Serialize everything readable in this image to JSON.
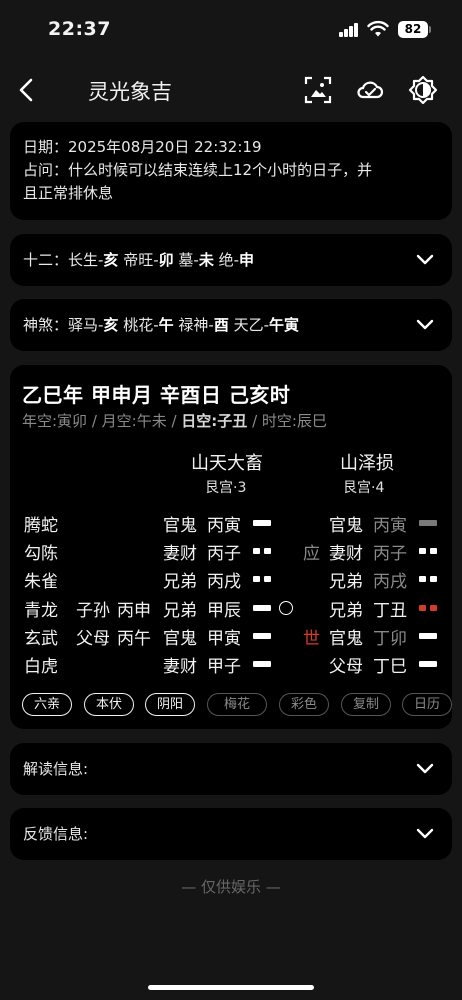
{
  "status": {
    "time": "22:37",
    "battery": "82"
  },
  "nav": {
    "title": "灵光象吉"
  },
  "info": {
    "date_line": "日期：2025年08月20日 22:32:19",
    "question_line1": "占问：什么时候可以结束连续上12个小时的日子，并",
    "question_line2": "且正常排休息"
  },
  "twelve": {
    "prefix": "十二：长生-",
    "b1": "亥",
    "t2": " 帝旺-",
    "b2": "卯",
    "t3": " 墓-",
    "b3": "未",
    "t4": " 绝-",
    "b4": "申"
  },
  "shensha": {
    "prefix": "神煞：驿马-",
    "b1": "亥",
    "t2": " 桃花-",
    "b2": "午",
    "t3": " 禄神-",
    "b3": "酉",
    "t4": " 天乙-",
    "b4": "午寅"
  },
  "gua": {
    "title": "乙巳年 甲申月 辛酉日 己亥时",
    "kong_a": "年空:寅卯 / 月空:午未 / ",
    "kong_b": "日空:子丑",
    "kong_c": " / 时空:辰巳",
    "main_name": "山天大畜",
    "main_palace": "艮宫·3",
    "change_name": "山泽损",
    "change_palace": "艮宫·4"
  },
  "rows": [
    {
      "god": "腾蛇",
      "fu_rel": "",
      "fu_branch": "",
      "rel": "官鬼",
      "branch": "丙寅",
      "line": "yang",
      "shi": "",
      "c_rel": "官鬼",
      "c_branch": "丙寅",
      "c_line": "yang-grey"
    },
    {
      "god": "勾陈",
      "fu_rel": "",
      "fu_branch": "",
      "rel": "妻财",
      "branch": "丙子",
      "line": "yin",
      "shi": "应",
      "c_rel": "妻财",
      "c_branch": "丙子",
      "c_line": "yin"
    },
    {
      "god": "朱雀",
      "fu_rel": "",
      "fu_branch": "",
      "rel": "兄弟",
      "branch": "丙戌",
      "line": "yin",
      "shi": "",
      "c_rel": "兄弟",
      "c_branch": "丙戌",
      "c_line": "yin"
    },
    {
      "god": "青龙",
      "fu_rel": "子孙",
      "fu_branch": "丙申",
      "rel": "兄弟",
      "branch": "甲辰",
      "line": "yang",
      "shi": "",
      "c_rel": "兄弟",
      "c_branch": "丁丑",
      "c_line": "yin-red"
    },
    {
      "god": "玄武",
      "fu_rel": "父母",
      "fu_branch": "丙午",
      "rel": "官鬼",
      "branch": "甲寅",
      "line": "yang",
      "shi": "世",
      "c_rel": "官鬼",
      "c_branch": "丁卯",
      "c_line": "yang"
    },
    {
      "god": "白虎",
      "fu_rel": "",
      "fu_branch": "",
      "rel": "妻财",
      "branch": "甲子",
      "line": "yang",
      "shi": "",
      "c_rel": "父母",
      "c_branch": "丁巳",
      "c_line": "yang"
    }
  ],
  "chips": [
    {
      "label": "六亲",
      "active": true
    },
    {
      "label": "本伏",
      "active": true
    },
    {
      "label": "阴阳",
      "active": true
    },
    {
      "label": "梅花",
      "active": false
    },
    {
      "label": "彩色",
      "active": false
    },
    {
      "label": "复制",
      "active": false
    },
    {
      "label": "日历",
      "active": false
    }
  ],
  "sections": {
    "interpret": "解读信息:",
    "feedback": "反馈信息:"
  },
  "footer": "— 仅供娱乐 —",
  "colors": {
    "background": "#151515",
    "card": "#000000",
    "accent_red": "#d33b2d",
    "dim_text": "#8a8a8a"
  },
  "icons": [
    "chevron-left-icon",
    "image-export-icon",
    "cloud-sync-icon",
    "brightness-icon",
    "chevron-down-icon",
    "moving-line-circle-icon"
  ]
}
